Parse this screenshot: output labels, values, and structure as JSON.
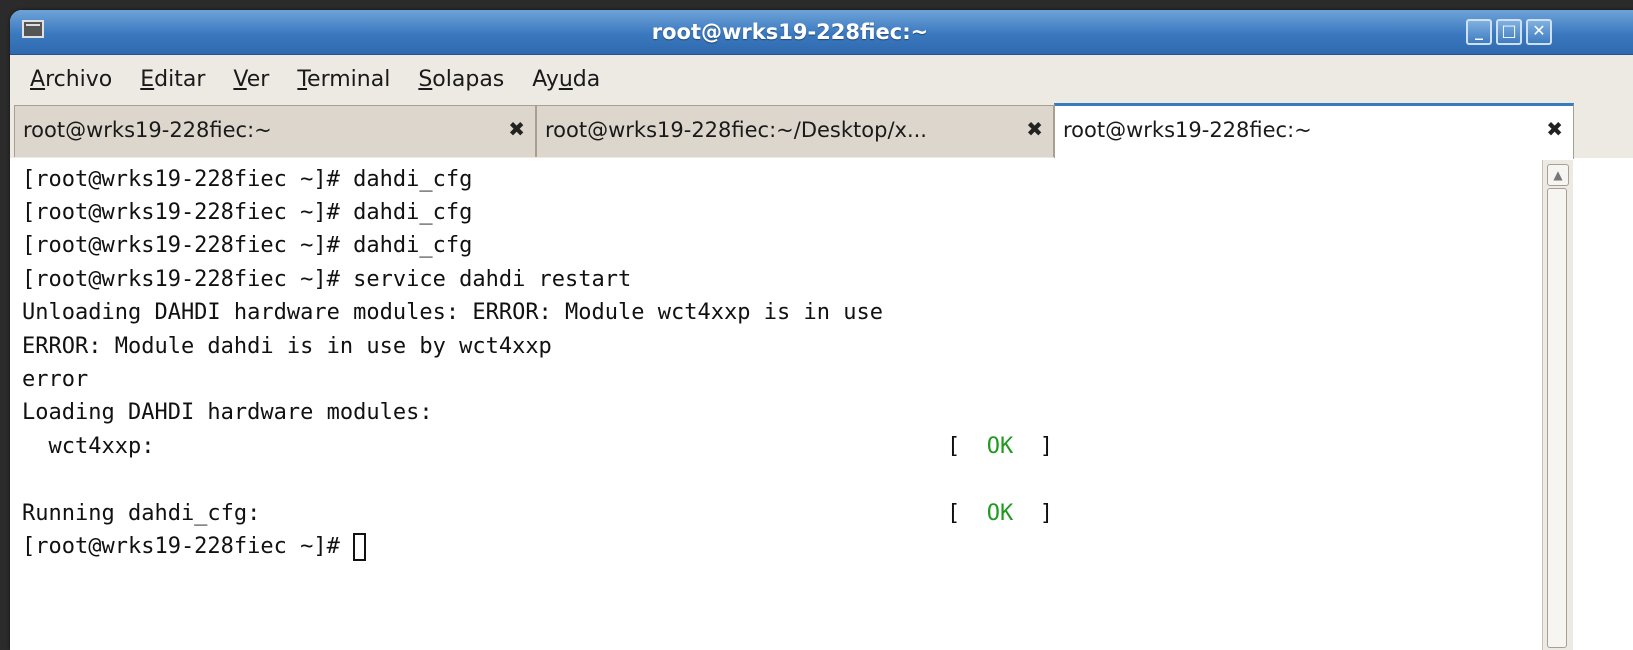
{
  "window": {
    "title": "root@wrks19-228fiec:~",
    "controls": {
      "minimize": "_",
      "maximize": "□",
      "close": "✕"
    }
  },
  "menu": [
    {
      "accel": "A",
      "rest": "rchivo"
    },
    {
      "accel": "E",
      "rest": "ditar"
    },
    {
      "accel": "V",
      "rest": "er"
    },
    {
      "accel": "T",
      "rest": "erminal"
    },
    {
      "accel": "S",
      "rest": "olapas"
    },
    {
      "pre": "Ay",
      "accel": "u",
      "rest": "da"
    }
  ],
  "tabs": [
    {
      "label": "root@wrks19-228fiec:~",
      "close": "✖"
    },
    {
      "label": "root@wrks19-228fiec:~/Desktop/x...",
      "close": "✖"
    },
    {
      "label": "root@wrks19-228fiec:~",
      "close": "✖"
    }
  ],
  "terminal": {
    "lines": [
      "[root@wrks19-228fiec ~]# dahdi_cfg",
      "[root@wrks19-228fiec ~]# dahdi_cfg",
      "[root@wrks19-228fiec ~]# dahdi_cfg",
      "[root@wrks19-228fiec ~]# service dahdi restart",
      "Unloading DAHDI hardware modules: ERROR: Module wct4xxp is in use",
      "ERROR: Module dahdi is in use by wct4xxp",
      "error",
      "Loading DAHDI hardware modules:"
    ],
    "wct_line": {
      "text": "  wct4xxp:",
      "open": "[",
      "status": "OK",
      "close": "]"
    },
    "running_line": {
      "text": "Running dahdi_cfg:",
      "open": "[",
      "status": "OK",
      "close": "]"
    },
    "prompt": "[root@wrks19-228fiec ~]# "
  },
  "colors": {
    "ok": "#1f9a1f",
    "titlebar": "#3a78bf",
    "chrome": "#ede9e3"
  },
  "icons": {
    "app": "terminal-icon",
    "scroll_up": "arrow-up-icon"
  }
}
